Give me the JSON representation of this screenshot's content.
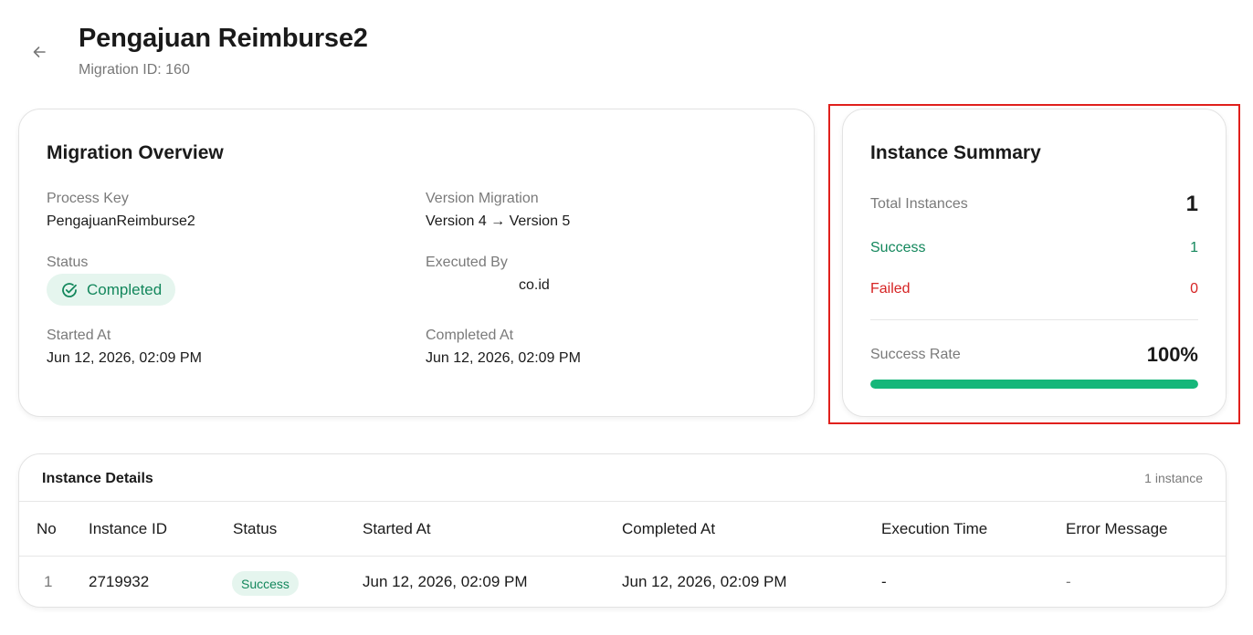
{
  "header": {
    "title": "Pengajuan Reimburse2",
    "subtitle": "Migration ID: 160"
  },
  "overview": {
    "title": "Migration Overview",
    "process_key_label": "Process Key",
    "process_key_value": "PengajuanReimburse2",
    "version_label": "Version Migration",
    "version_value": "Version 4 → Version 5",
    "status_label": "Status",
    "status_value": "Completed",
    "executed_by_label": "Executed By",
    "executed_by_value": "co.id",
    "started_label": "Started At",
    "started_value": "Jun 12, 2026, 02:09 PM",
    "completed_label": "Completed At",
    "completed_value": "Jun 12, 2026, 02:09 PM"
  },
  "summary": {
    "title": "Instance Summary",
    "total_label": "Total Instances",
    "total_value": "1",
    "success_label": "Success",
    "success_value": "1",
    "failed_label": "Failed",
    "failed_value": "0",
    "rate_label": "Success Rate",
    "rate_value": "100%",
    "rate_fraction": 1.0
  },
  "details": {
    "title": "Instance Details",
    "count": "1 instance",
    "columns": [
      "No",
      "Instance ID",
      "Status",
      "Started At",
      "Completed At",
      "Execution Time",
      "Error Message"
    ],
    "rows": [
      {
        "no": "1",
        "instance_id": "2719932",
        "status": "Success",
        "started": "Jun 12, 2026, 02:09 PM",
        "completed": "Jun 12, 2026, 02:09 PM",
        "execution_time": "-",
        "error_message": "-"
      }
    ]
  },
  "colors": {
    "success": "#13875c",
    "failed": "#d62424",
    "progress": "#16b77a",
    "highlight": "#e0201c"
  },
  "icons": {
    "back": "arrow-left-icon",
    "status": "check-circle-icon"
  }
}
